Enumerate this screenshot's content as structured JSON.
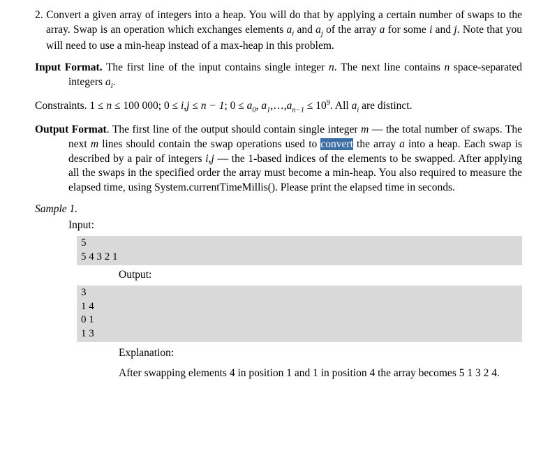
{
  "q": {
    "num": "2.",
    "intro_a": "Convert a given array of integers into a heap. You will do that by applying a certain number of swaps to the array. Swap is an operation which exchanges elements ",
    "ai": "a",
    "ai_sub": "i",
    "intro_b": " and ",
    "aj": "a",
    "aj_sub": "j",
    "intro_c": " of the array ",
    "arr": "a",
    "intro_d": " for some ",
    "ivar": "i",
    "intro_e": " and ",
    "jvar": "j",
    "intro_f": ". Note that you will need to use a min-heap instead of a max-heap in this problem."
  },
  "input": {
    "label": "Input Format.",
    "text_a": " The first line of the input contains single integer ",
    "n": "n",
    "text_b": ". The next line contains ",
    "text_c": " space-separated integers ",
    "ai": "a",
    "ai_sub": "i",
    "text_d": "."
  },
  "constraints": {
    "label": "Constraints.",
    "c1": " 1 ≤ ",
    "n": "n",
    "c2": " ≤ 100 000; 0 ≤ ",
    "ij": "i,j",
    "c3": " ≤ ",
    "nm1": "n − 1",
    "c4": "; 0 ≤ ",
    "a0": "a",
    "a0s": "0",
    "comma": ", ",
    "a1": "a",
    "a1s": "1",
    "dots": ",…,",
    "an": "a",
    "ans": "n−1",
    "c5": " ≤ 10",
    "exp": "9",
    "c6": ". All ",
    "ai": "a",
    "ais": "i",
    "c7": " are distinct."
  },
  "output": {
    "label": "Output Format",
    "text_a": ". The first line of the output should contain single integer ",
    "m": "m",
    "text_b": " — the total number of swaps. The next ",
    "text_c": " lines should contain the swap operations used to ",
    "hl": "convert",
    "text_d": " the array ",
    "arr": "a",
    "text_e": " into a heap. Each swap is described by a pair of integers ",
    "ij": "i,j",
    "text_f": " — the 1-based indices of the elements to be swapped. After applying all the swaps in the specified order the array must become a min-heap. You also required to measure the elapsed time, using System.currentTimeMillis(). Please print the elapsed time in seconds."
  },
  "sample": {
    "label": "Sample 1.",
    "input_label": "Input:",
    "output_label": "Output:",
    "in_line1": "5",
    "in_line2": "5 4 3 2 1",
    "out_line1": "3",
    "out_line2": "1 4",
    "out_line3": "0 1",
    "out_line4": "1 3",
    "expl_label": "Explanation:",
    "expl_text": "After swapping elements 4 in position 1 and 1 in position 4 the array becomes 5 1 3 2 4."
  }
}
